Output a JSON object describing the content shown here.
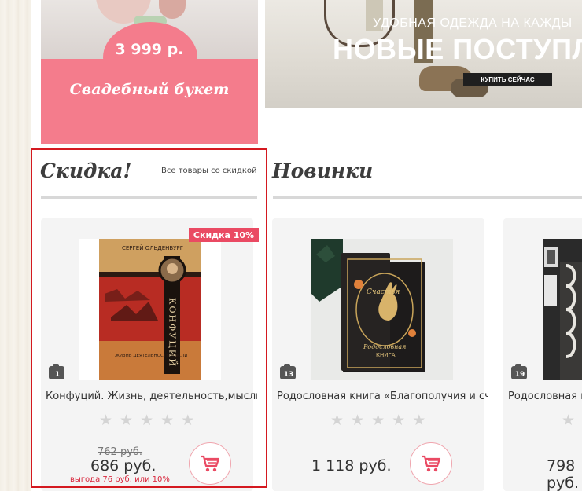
{
  "promo": {
    "price": "3 999 р.",
    "title": "Свадебный букет"
  },
  "banner": {
    "subtitle": "УДОБНАЯ ОДЕЖДА НА КАЖДЫ",
    "title": "НОВЫЕ ПОСТУПЛ",
    "button": "КУПИТЬ СЕЙЧАС"
  },
  "sections": {
    "discount": {
      "title": "Скидка!",
      "link": "Все товары со скидкой"
    },
    "new": {
      "title": "Новинки"
    }
  },
  "products": [
    {
      "badge": "Скидка 10%",
      "photos": "1",
      "title": "Конфуций. Жизнь, деятельность,мысли",
      "old_price": "762 руб.",
      "price": "686 руб.",
      "saving": "выгода 76 руб. или 10%",
      "book": {
        "author": "СЕРГЕЙ ОЛЬДЕНБУРГ",
        "name": "КОНФУЦИЙ",
        "subtitle": "ЖИЗНЬ ДЕЯТЕЛЬНОСТЬ МЫСЛИ"
      }
    },
    {
      "photos": "13",
      "title": "Родословная книга «Благополучия и счастья»",
      "price": "1 118 руб.",
      "book": {
        "name": "Родословная",
        "subtitle": "КНИГА"
      }
    },
    {
      "photos": "19",
      "title": "Родословная книга",
      "price": "798 руб."
    }
  ],
  "colors": {
    "accent_pink": "#f47c8c",
    "badge_red": "#ea4a63",
    "saving_red": "#d8243a",
    "highlight_red": "#d41920"
  },
  "icons": {
    "star": "★",
    "cart": "shopping-cart-icon",
    "camera": "camera-icon"
  }
}
